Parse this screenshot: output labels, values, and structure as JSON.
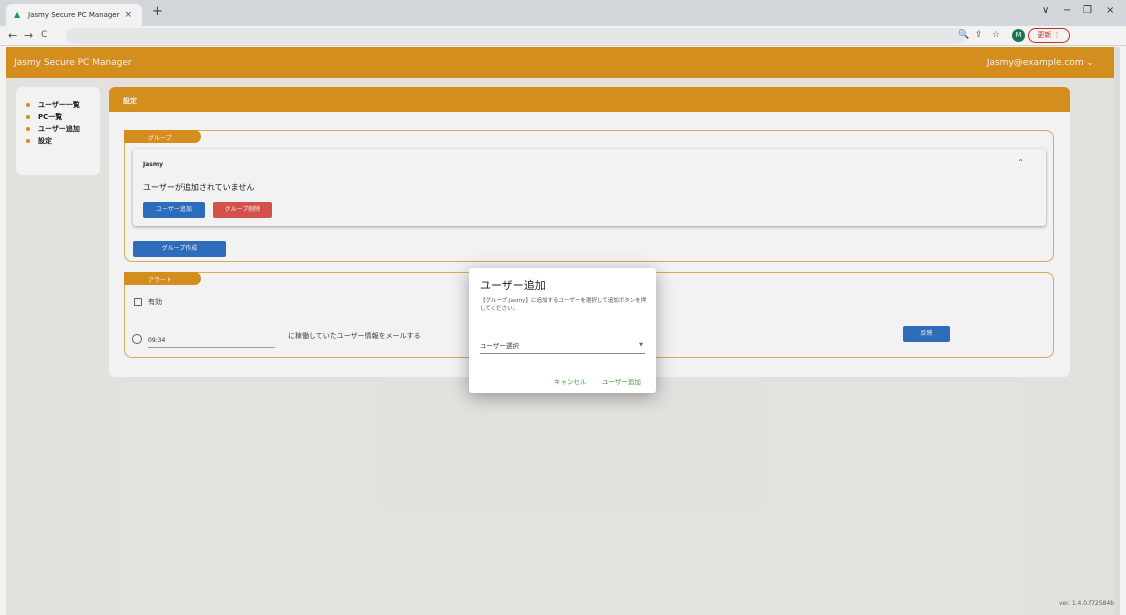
{
  "browser": {
    "tab_title": "Jasmy Secure PC Manager",
    "new_tab": "+",
    "tab_close": "×",
    "window_controls": [
      "∨",
      "−",
      "❐",
      "×"
    ],
    "nav": [
      "←",
      "→",
      "C"
    ],
    "right_icons": [
      "🔍",
      "⇪",
      "☆",
      "❐"
    ],
    "avatar": "M",
    "update_label": "更新 ⋮"
  },
  "app": {
    "title": "Jasmy Secure PC Manager",
    "user": "Jasmy@example.com ⌄",
    "version": "ver. 1.4.0.f72584b"
  },
  "sidebar": {
    "items": [
      {
        "label": "ユーザー一覧"
      },
      {
        "label": "PC一覧"
      },
      {
        "label": "ユーザー追加"
      },
      {
        "label": "設定"
      }
    ]
  },
  "settings": {
    "title": "設定",
    "group_section": {
      "legend": "グループ",
      "group_name": "Jasmy",
      "empty_message": "ユーザーが追加されていません",
      "add_user_label": "ユーザー追加",
      "delete_group_label": "グループ削除",
      "create_group_label": "グループ作成"
    },
    "alert_section": {
      "legend": "アラート",
      "enable_label": "有効",
      "time_value": "09:34",
      "mail_text": "に稼働していたユーザー情報をメールする",
      "apply_label": "反映"
    }
  },
  "dialog": {
    "title": "ユーザー追加",
    "description": "【グループ:Jasmy】に追加するユーザーを選択して追加ボタンを押してください。",
    "select_placeholder": "ユーザー選択",
    "cancel_label": "キャンセル",
    "confirm_label": "ユーザー追加"
  }
}
